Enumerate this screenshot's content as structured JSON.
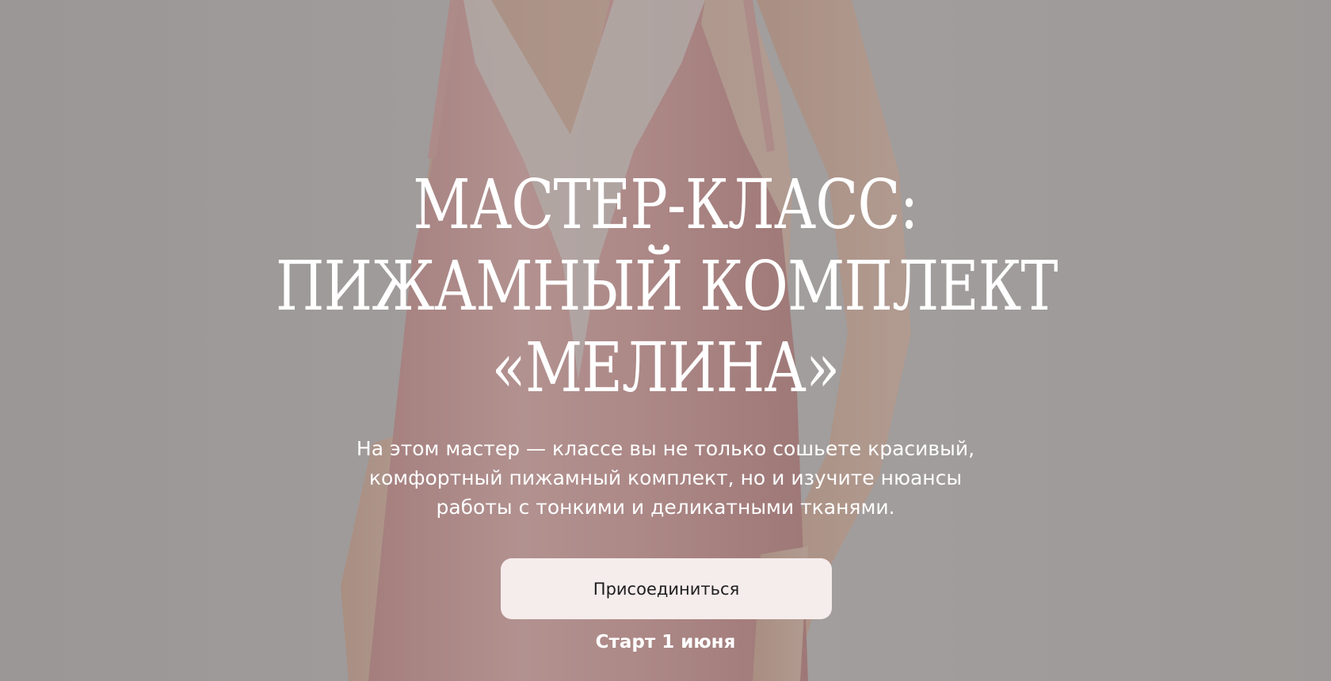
{
  "hero": {
    "title_lines": [
      "Мастер-класс:",
      "пижамный комплект",
      "«Мелина»"
    ],
    "description_lines": [
      "На этом мастер — классе вы не только сошьете красивый,",
      "комфортный пижамный комплект, но и изучите нюансы",
      "работы с тонкими и деликатными тканями."
    ],
    "join_button_label": "Присоединиться",
    "start_label": "Старт 1 июня"
  },
  "colors": {
    "button_background": "#f5ecec",
    "text": "#ffffff",
    "garment": "#e6aaa8"
  }
}
